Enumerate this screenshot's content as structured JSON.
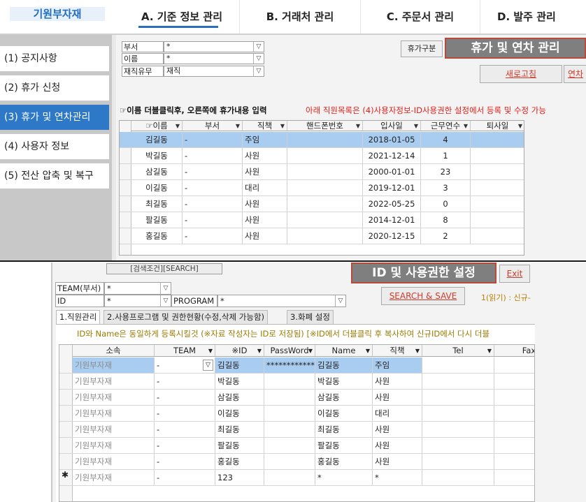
{
  "top": {
    "brand": "기원부자재",
    "nav": [
      {
        "label": "A. 기준 정보 관리",
        "active": true
      },
      {
        "label": "B. 거래처 관리"
      },
      {
        "label": "C. 주문서 관리"
      },
      {
        "label": "D. 발주 관리"
      }
    ],
    "sidebar": [
      {
        "label": "(1) 공지사항"
      },
      {
        "label": "(2) 휴가 신청"
      },
      {
        "label": "(3) 휴가 및 연차관리",
        "active": true
      },
      {
        "label": "(4) 사용자 정보"
      },
      {
        "label": "(5) 전산 압축 및 복구"
      }
    ],
    "filters": {
      "dept_label": "부서",
      "dept_value": "*",
      "name_label": "이름",
      "name_value": "*",
      "status_label": "재직유무",
      "status_value": "재직"
    },
    "leave_type_button": "휴가구분",
    "title": "휴가 및 연차 관리",
    "refresh_button": "새로고침",
    "annual_button": "연차",
    "hint_left": "☞이름 더블클릭후, 오른쪽에 휴가내용 입력",
    "hint_right": "아래 직원목록은 (4)사용자정보-ID사용권한 설정에서 등록 및 수정 가능",
    "grid": {
      "columns": [
        "☞이름",
        "부서",
        "직책",
        "핸드폰번호",
        "입사일",
        "근무연수",
        "퇴사일"
      ],
      "rows": [
        {
          "name": "김길동",
          "dept": "-",
          "position": "주임",
          "phone": "",
          "joined": "2018-01-05",
          "years": "4",
          "left": ""
        },
        {
          "name": "박길동",
          "dept": "-",
          "position": "사원",
          "phone": "",
          "joined": "2021-12-14",
          "years": "1",
          "left": ""
        },
        {
          "name": "삼길동",
          "dept": "-",
          "position": "사원",
          "phone": "",
          "joined": "2000-01-01",
          "years": "23",
          "left": ""
        },
        {
          "name": "이길동",
          "dept": "-",
          "position": "대리",
          "phone": "",
          "joined": "2019-12-01",
          "years": "3",
          "left": ""
        },
        {
          "name": "최길동",
          "dept": "-",
          "position": "사원",
          "phone": "",
          "joined": "2022-05-25",
          "years": "0",
          "left": ""
        },
        {
          "name": "팔길동",
          "dept": "-",
          "position": "사원",
          "phone": "",
          "joined": "2014-12-01",
          "years": "8",
          "left": ""
        },
        {
          "name": "홍길동",
          "dept": "-",
          "position": "사원",
          "phone": "",
          "joined": "2020-12-15",
          "years": "2",
          "left": ""
        }
      ]
    }
  },
  "bottom": {
    "search_condition": "[검색조건][SEARCH]",
    "title": "ID 및 사용권한 설정",
    "exit_button": "Exit",
    "save_button": "SEARCH & SAVE",
    "permission_note": "1(읽기) : 신규-",
    "team_label": "TEAM(부서)",
    "team_value": "*",
    "id_label": "ID",
    "id_value": "*",
    "program_label": "PROGRAM",
    "program_value": "*",
    "tabs": [
      {
        "label": "1.직원관리",
        "active": true
      },
      {
        "label": "2.사용프로그램 및 권한현황(수정,삭제 가능함)"
      },
      {
        "label": "3.화폐 설정"
      }
    ],
    "id_note": "ID와 Name은 동일하게 등록시킬것 (※자료 작성자는 ID로 저장됨)  [※ID에서 더블클릭 후 복사하여 신규ID에서 다시 더블",
    "grid": {
      "columns": [
        "소속",
        "TEAM",
        "※ID",
        "PassWord",
        "Name",
        "직책",
        "Tel",
        "Fax"
      ],
      "rows": [
        {
          "org": "기원부자재",
          "team": "-",
          "id": "김길동",
          "password": "***************",
          "name": "김길동",
          "position": "주임",
          "tel": "",
          "fax": ""
        },
        {
          "org": "기원부자재",
          "team": "-",
          "id": "박길동",
          "password": "",
          "name": "박길동",
          "position": "사원",
          "tel": "",
          "fax": ""
        },
        {
          "org": "기원부자재",
          "team": "-",
          "id": "삼길동",
          "password": "",
          "name": "삼길동",
          "position": "사원",
          "tel": "",
          "fax": ""
        },
        {
          "org": "기원부자재",
          "team": "-",
          "id": "이길동",
          "password": "",
          "name": "이길동",
          "position": "대리",
          "tel": "",
          "fax": ""
        },
        {
          "org": "기원부자재",
          "team": "-",
          "id": "최길동",
          "password": "",
          "name": "최길동",
          "position": "사원",
          "tel": "",
          "fax": ""
        },
        {
          "org": "기원부자재",
          "team": "-",
          "id": "팔길동",
          "password": "",
          "name": "팔길동",
          "position": "사원",
          "tel": "",
          "fax": ""
        },
        {
          "org": "기원부자재",
          "team": "-",
          "id": "홍길동",
          "password": "",
          "name": "홍길동",
          "position": "사원",
          "tel": "",
          "fax": ""
        },
        {
          "org": "기원부자재",
          "team": "-",
          "id": "123",
          "password": "",
          "name": "*",
          "position": "*",
          "tel": "",
          "fax": ""
        }
      ],
      "new_row_marker": "✱"
    }
  },
  "colors": {
    "accent_blue": "#2d79c7",
    "selection": "#a9cdf0",
    "title_bg": "#7f7f7f",
    "title_border": "#b94a3a",
    "link_red": "#d23a2a"
  }
}
